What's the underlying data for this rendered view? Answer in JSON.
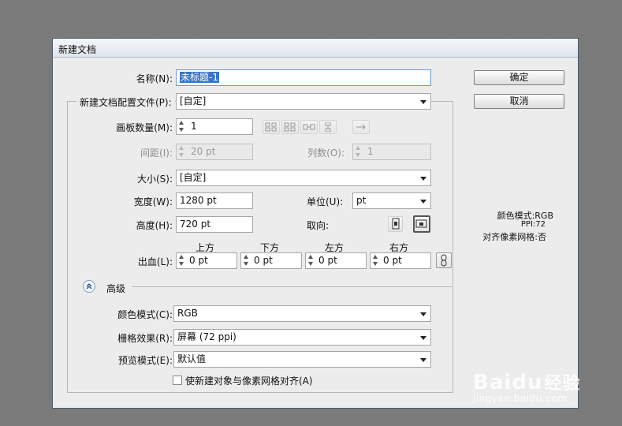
{
  "window": {
    "title": "新建文档"
  },
  "fields": {
    "name": {
      "label": "名称(N):",
      "value": "未标题-1"
    },
    "profile": {
      "label": "新建文档配置文件(P):",
      "value": "[自定]"
    },
    "artboards": {
      "label": "画板数量(M):",
      "value": "1"
    },
    "spacing": {
      "label": "间距(I):",
      "value": "20 pt"
    },
    "columns": {
      "label": "列数(O):",
      "value": "1"
    },
    "size": {
      "label": "大小(S):",
      "value": "[自定]"
    },
    "width": {
      "label": "宽度(W):",
      "value": "1280 pt"
    },
    "units": {
      "label": "单位(U):",
      "value": "pt"
    },
    "height": {
      "label": "高度(H):",
      "value": "720 pt"
    },
    "orientation": {
      "label": "取向:"
    },
    "bleed": {
      "label": "出血(L):",
      "headers": [
        "上方",
        "下方",
        "左方",
        "右方"
      ],
      "values": [
        "0 pt",
        "0 pt",
        "0 pt",
        "0 pt"
      ]
    }
  },
  "advanced": {
    "label": "高级",
    "color_mode": {
      "label": "颜色模式(C):",
      "value": "RGB"
    },
    "raster_effects": {
      "label": "栅格效果(R):",
      "value": "屏幕 (72 ppi)"
    },
    "preview_mode": {
      "label": "预览模式(E):",
      "value": "默认值"
    },
    "align_checkbox": {
      "label": "使新建对象与像素网格对齐(A)",
      "checked": false
    }
  },
  "buttons": {
    "ok": "确定",
    "cancel": "取消"
  },
  "summary": {
    "color_mode": "颜色模式:RGB",
    "ppi": "PPI:72",
    "pixel_grid": "对齐像素网格:否"
  },
  "watermark": {
    "brand": "Baidu",
    "cn": "经验",
    "url": "jingyan.baidu.com"
  },
  "colors": {
    "selection": "#3d73c4",
    "dialog_bg": "#ececec",
    "titlebar": "#dfe5ec",
    "desktop": "#7a7a7a"
  },
  "icons": [
    "spinner-icon",
    "arrange-grid-by-row-icon",
    "arrange-grid-by-column-icon",
    "arrange-by-row-icon",
    "arrange-by-column-icon",
    "right-to-left-icon",
    "portrait-icon",
    "landscape-icon",
    "link-icon",
    "collapse-icon"
  ]
}
